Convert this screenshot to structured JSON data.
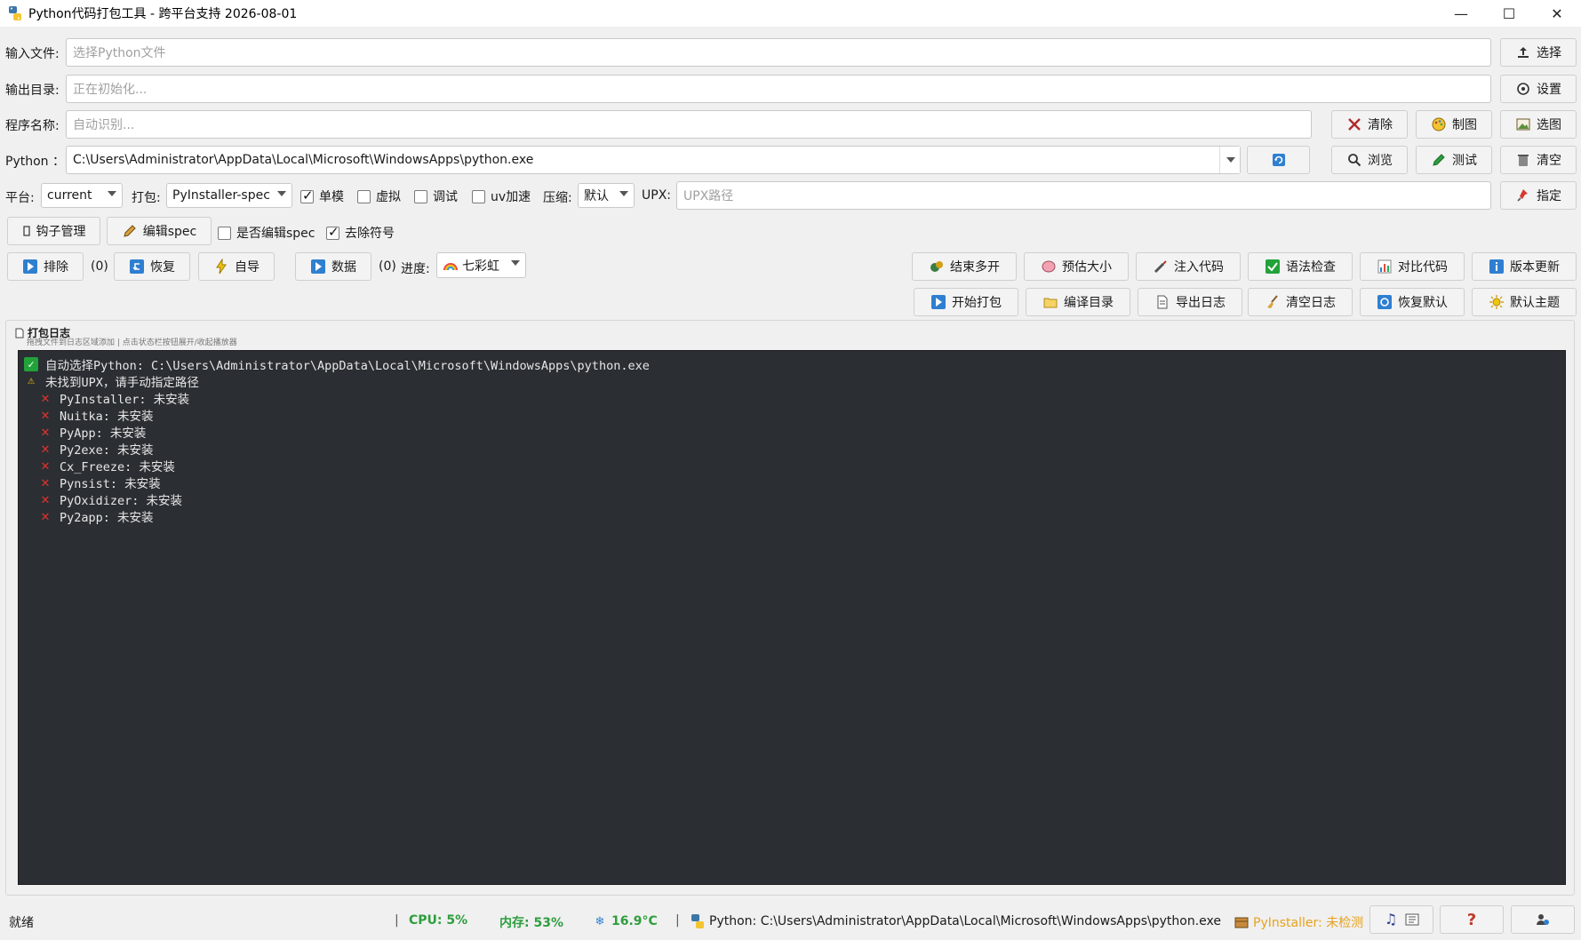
{
  "window": {
    "title": "Python代码打包工具 - 跨平台支持 2026-08-01",
    "minimize": "—",
    "maximize": "☐",
    "close": "✕"
  },
  "input_file": {
    "label": "输入文件:",
    "placeholder": "选择Python文件",
    "button": "选择"
  },
  "output_dir": {
    "label": "输出目录:",
    "placeholder": "正在初始化...",
    "button": "设置"
  },
  "program_name": {
    "label": "程序名称:",
    "placeholder": "自动识别...",
    "buttons": {
      "clear": "清除",
      "make_icon": "制图",
      "pick_icon": "选图"
    }
  },
  "python": {
    "label": "Python ：",
    "value": "C:\\Users\\Administrator\\AppData\\Local\\Microsoft\\WindowsApps\\python.exe",
    "buttons": {
      "browse": "浏览",
      "test": "测试",
      "empty": "清空"
    }
  },
  "options": {
    "platform_label": "平台:",
    "platform_value": "current",
    "pack_label": "打包:",
    "pack_value": "PyInstaller-spec",
    "single_label": "单模",
    "single_checked": true,
    "virtual_label": "虚拟",
    "virtual_checked": false,
    "debug_label": "调试",
    "debug_checked": false,
    "uv_label": "uv加速",
    "uv_checked": false,
    "compress_label": "压缩:",
    "compress_value": "默认",
    "upx_label": "UPX:",
    "upx_placeholder": "UPX路径",
    "assign_button": "指定"
  },
  "row2": {
    "hooks_button": "钩子管理",
    "edit_spec_button": "编辑spec",
    "edit_spec_check_label": "是否编辑spec",
    "edit_spec_checked": false,
    "strip_label": "去除符号",
    "strip_checked": true
  },
  "row3": {
    "exclude_button": "排除",
    "exclude_count": "(0)",
    "restore_button": "恢复",
    "auto_import_button": "自导",
    "data_button": "数据",
    "data_count": "(0)",
    "progress_label": "进度:",
    "progress_style": "七彩虹"
  },
  "actions_top": [
    "结束多开",
    "预估大小",
    "注入代码",
    "语法检查",
    "对比代码",
    "版本更新"
  ],
  "actions_bottom": [
    "开始打包",
    "编译目录",
    "导出日志",
    "清空日志",
    "恢复默认",
    "默认主题"
  ],
  "log": {
    "title": "打包日志",
    "hint": "拖拽文件到日志区域添加 | 点击状态栏按钮展开/收起播放器",
    "lines": [
      {
        "type": "ok",
        "text": "自动选择Python: C:\\Users\\Administrator\\AppData\\Local\\Microsoft\\WindowsApps\\python.exe"
      },
      {
        "type": "warn",
        "text": "未找到UPX，请手动指定路径"
      },
      {
        "type": "err",
        "text": "PyInstaller: 未安装"
      },
      {
        "type": "err",
        "text": "Nuitka: 未安装"
      },
      {
        "type": "err",
        "text": "PyApp: 未安装"
      },
      {
        "type": "err",
        "text": "Py2exe: 未安装"
      },
      {
        "type": "err",
        "text": "Cx_Freeze: 未安装"
      },
      {
        "type": "err",
        "text": "Pynsist: 未安装"
      },
      {
        "type": "err",
        "text": "PyOxidizer: 未安装"
      },
      {
        "type": "err",
        "text": "Py2app: 未安装"
      }
    ]
  },
  "status": {
    "ready": "就绪",
    "separator": "|",
    "cpu": "CPU: 5%",
    "memory": "内存: 53%",
    "temp": "16.9°C",
    "python": "Python: C:\\Users\\Administrator\\AppData\\Local\\Microsoft\\WindowsApps\\python.exe",
    "pyinstaller": "PyInstaller: 未检测",
    "help": "?"
  },
  "colors": {
    "console_bg": "#2b2f33",
    "status_green": "#2e9e3e",
    "status_orange": "#e6a21e",
    "error_red": "#e2312d"
  }
}
